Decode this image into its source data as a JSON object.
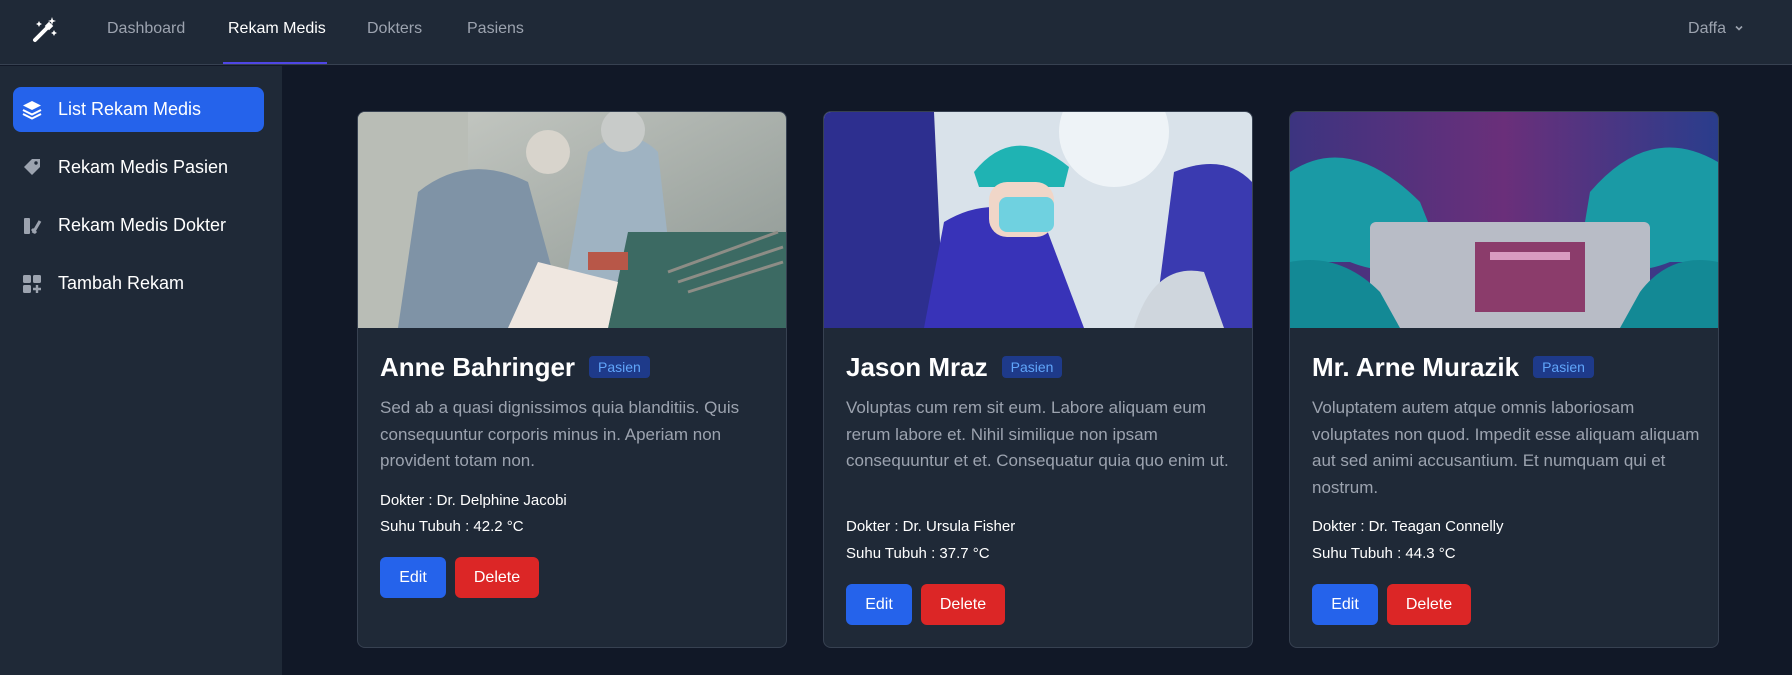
{
  "topnav": {
    "logo_icon": "magic-wand-icon",
    "links": [
      "Dashboard",
      "Rekam Medis",
      "Dokters",
      "Pasiens"
    ],
    "active": "Rekam Medis",
    "user_name": "Daffa"
  },
  "sidebar": {
    "items": [
      {
        "label": "List Rekam Medis",
        "icon": "layers-icon",
        "active": true
      },
      {
        "label": "Rekam Medis Pasien",
        "icon": "tag-icon",
        "active": false
      },
      {
        "label": "Rekam Medis Dokter",
        "icon": "user-list-icon",
        "active": false
      },
      {
        "label": "Tambah Rekam",
        "icon": "apps-add-icon",
        "active": false
      }
    ]
  },
  "cards": [
    {
      "name": "Anne Bahringer",
      "badge": "Pasien",
      "description": "Sed ab a quasi dignissimos quia blanditiis. Quis consequuntur corporis minus in. Aperiam non provident totam non.",
      "doctor": "Dokter : Dr. Delphine Jacobi",
      "temperature": "Suhu Tubuh : 42.2 °C",
      "edit_label": "Edit",
      "delete_label": "Delete"
    },
    {
      "name": "Jason Mraz",
      "badge": "Pasien",
      "description": "Voluptas cum rem sit eum. Labore aliquam eum rerum labore et. Nihil similique non ipsam consequuntur et et. Consequatur quia quo enim ut.",
      "doctor": "Dokter : Dr. Ursula Fisher",
      "temperature": "Suhu Tubuh : 37.7 °C",
      "edit_label": "Edit",
      "delete_label": "Delete"
    },
    {
      "name": "Mr. Arne Murazik",
      "badge": "Pasien",
      "description": "Voluptatem autem atque omnis laboriosam voluptates non quod. Impedit esse aliquam aliquam aut sed animi accusantium. Et numquam qui et nostrum.",
      "doctor": "Dokter : Dr. Teagan Connelly",
      "temperature": "Suhu Tubuh : 44.3 °C",
      "edit_label": "Edit",
      "delete_label": "Delete"
    }
  ],
  "colors": {
    "background": "#111827",
    "panel": "#1f2937",
    "primary": "#2563eb",
    "danger": "#dc2626",
    "badge_bg": "#1e3a8a",
    "badge_text": "#60a5fa"
  }
}
